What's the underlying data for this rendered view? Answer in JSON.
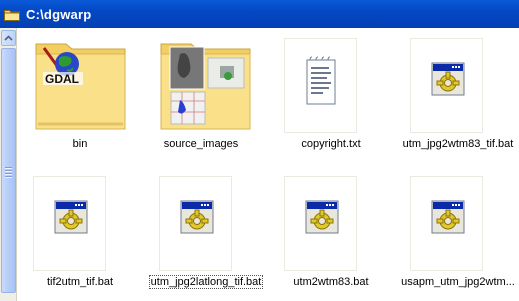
{
  "window": {
    "title": "C:\\dgwarp"
  },
  "icons": {
    "folder": "folder-icon",
    "scroll_up": "chevron-up-icon"
  },
  "files": [
    {
      "name": "bin",
      "type": "folder",
      "icon": "gdal-logo-icon"
    },
    {
      "name": "source_images",
      "type": "folder",
      "icon": "image-thumbnails-icon"
    },
    {
      "name": "copyright.txt",
      "type": "text",
      "icon": "notepad-icon"
    },
    {
      "name": "utm_jpg2wtm83_tif.bat",
      "type": "batch",
      "icon": "batch-gear-icon"
    },
    {
      "name": "tif2utm_tif.bat",
      "type": "batch",
      "icon": "batch-gear-icon"
    },
    {
      "name": "utm_jpg2latlong_tif.bat",
      "type": "batch",
      "icon": "batch-gear-icon",
      "selected": true
    },
    {
      "name": "utm2wtm83.bat",
      "type": "batch",
      "icon": "batch-gear-icon"
    },
    {
      "name": "usapm_utm_jpg2wtm...",
      "type": "batch",
      "icon": "batch-gear-icon"
    }
  ],
  "colors": {
    "titlebar": "#0447c5",
    "folder": "#f9dc7c",
    "gear": "#e2c92a"
  }
}
